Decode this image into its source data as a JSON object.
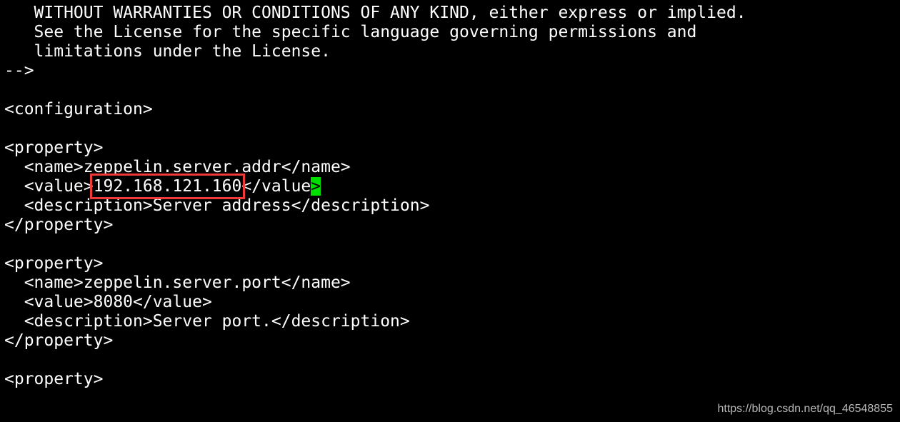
{
  "lines": [
    "   WITHOUT WARRANTIES OR CONDITIONS OF ANY KIND, either express or implied.",
    "   See the License for the specific language governing permissions and",
    "   limitations under the License.",
    "-->",
    "",
    "<configuration>",
    "",
    "<property>",
    "  <name>zeppelin.server.addr</name>",
    "",
    "  <description>Server address</description>",
    "</property>",
    "",
    "<property>",
    "  <name>zeppelin.server.port</name>",
    "  <value>8080</value>",
    "  <description>Server port.</description>",
    "</property>",
    "",
    "<property>"
  ],
  "value_line": {
    "prefix": "  <value>",
    "highlighted": "192.168.121.160",
    "suffix": "</value",
    "cursor_char": ">"
  },
  "colors": {
    "highlight_box": "#f03a3a",
    "cursor": "#00e000"
  },
  "watermark": "https://blog.csdn.net/qq_46548855"
}
